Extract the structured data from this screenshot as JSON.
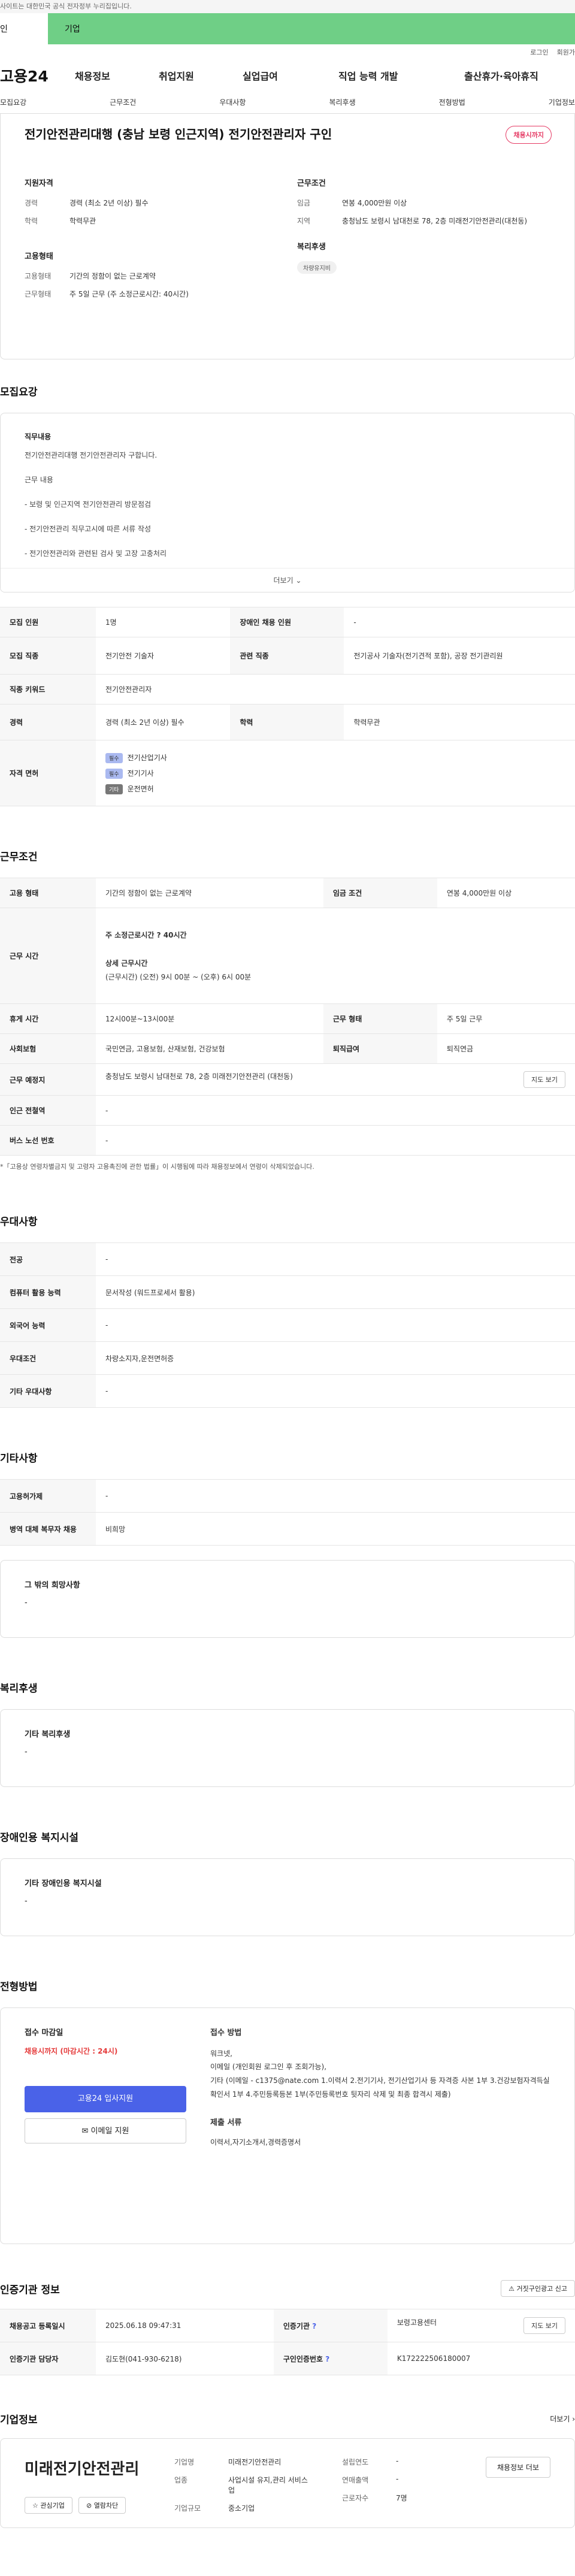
{
  "top": {
    "notice": "사이트는 대한민국 공식 전자정부 누리집입니다.",
    "tab_personal": "인",
    "tab_enterprise": "기업",
    "login": "로그인",
    "join": "회원가"
  },
  "gnb": {
    "logo": "고용24",
    "items": [
      "채용정보",
      "취업지원",
      "실업급여",
      "직업 능력 개발",
      "출산휴가·육아휴직"
    ]
  },
  "subnav": [
    "모집요강",
    "근무조건",
    "우대사항",
    "복리후생",
    "전형방법",
    "기업정보"
  ],
  "header": {
    "title": "전기안전관리대행 (충남 보령 인근지역) 전기안전관리자 구인",
    "badge": "채용시까지",
    "qual_title": "지원자격",
    "qual": [
      {
        "k": "경력",
        "v": "경력 (최소 2년 이상) 필수"
      },
      {
        "k": "학력",
        "v": "학력무관"
      }
    ],
    "emp_title": "고용형태",
    "emp": [
      {
        "k": "고용형태",
        "v": "기간의 정함이 없는 근로계약"
      },
      {
        "k": "근무형태",
        "v": "주 5일 근무 (주 소정근로시간: 40시간)"
      }
    ],
    "cond_title": "근무조건",
    "cond": [
      {
        "k": "임금",
        "v": "연봉 4,000만원 이상"
      },
      {
        "k": "지역",
        "v": "충청남도 보령시 남대천로 78, 2층 미래전기안전관리(대천동)"
      }
    ],
    "welfare_title": "복리후생",
    "welfare_chip": "차량유지비"
  },
  "recruit": {
    "section": "모집요강",
    "desc_title": "직무내용",
    "lines": [
      "전기안전관리대행 전기안전관리자 구합니다.",
      "근무 내용",
      "- 보령 및 인근지역 전기안전관리 방문점검",
      "- 전기안전관리 직무고시에 따른 서류 작성",
      "- 전기안전관리와 관련된 검사 및 고장 고충처리"
    ],
    "more": "더보기",
    "rows": [
      [
        "모집 인원",
        "1명",
        "장애인 채용 인원",
        "-"
      ],
      [
        "모집 직종",
        "전기안전 기술자",
        "관련 직종",
        "전기공사 기술자(전기견적 포함), 공장 전기관리원"
      ],
      [
        "직종 키워드",
        "전기안전관리자",
        "",
        ""
      ],
      [
        "경력",
        "경력 (최소 2년 이상) 필수",
        "학력",
        "학력무관"
      ]
    ],
    "license_label": "자격 면허",
    "licenses": [
      {
        "tag": "필수",
        "name": "전기산업기사"
      },
      {
        "tag": "필수",
        "name": "전기기사"
      },
      {
        "tag": "기타",
        "name": "운전면허"
      }
    ]
  },
  "work": {
    "section": "근무조건",
    "emp_k": "고용 형태",
    "emp_v": "기간의 정함이 없는 근로계약",
    "pay_k": "임금 조건",
    "pay_v": "연봉 4,000만원 이상",
    "time_k": "근무 시간",
    "time_main": "주 소정근로시간 ? 40시간",
    "time_detail_title": "상세 근무시간",
    "time_detail": "(근무시간) (오전) 9시 00분 ~ (오후) 6시 00분",
    "break_k": "휴게 시간",
    "break_v": "12시00분~13시00분",
    "form_k": "근무 형태",
    "form_v": "주 5일 근무",
    "ins_k": "사회보험",
    "ins_v": "국민연금, 고용보험, 산재보험, 건강보험",
    "ret_k": "퇴직급여",
    "ret_v": "퇴직연금",
    "place_k": "근무 예정지",
    "place_v": "충청남도 보령시 남대천로 78, 2층 미래전기안전관리 (대천동)",
    "map_btn": "지도 보기",
    "sub_k": "인근 전철역",
    "sub_v": "-",
    "bus_k": "버스 노선 번호",
    "bus_v": "-",
    "note": "*「고용상 연령차별금지 및 고령자 고용촉진에 관한 법률」이 시행됨에 따라 채용정보에서 연령이 삭제되었습니다."
  },
  "pref": {
    "section": "우대사항",
    "rows": [
      [
        "전공",
        "-"
      ],
      [
        "컴퓨터 활용 능력",
        "문서작성 (워드프로세서 활용)"
      ],
      [
        "외국어 능력",
        "-"
      ],
      [
        "우대조건",
        "차량소지자,운전면허증"
      ],
      [
        "기타 우대사항",
        "-"
      ]
    ]
  },
  "etc": {
    "section": "기타사항",
    "rows": [
      [
        "고용허가제",
        "-"
      ],
      [
        "병역 대체 복무자 채용",
        "비희망"
      ]
    ],
    "box_title": "그 밖의 희망사항",
    "box_v": "-"
  },
  "welfare": {
    "section": "복리후생",
    "title": "기타 복리후생",
    "v": "-"
  },
  "disabled": {
    "section": "장애인용 복지시설",
    "title": "기타 장애인용 복지시설",
    "v": "-"
  },
  "apply": {
    "section": "전형방법",
    "deadline_title": "접수 마감일",
    "deadline": "채용시까지 (마감시간 : 24시)",
    "method_title": "접수 방법",
    "methods": [
      "워크넷,",
      "이메일 (개인회원 로그인 후 조회가능),",
      "기타 (이메일 - c1375@nate.com 1.이력서 2.전기기사, 전기산업기사 등 자격증 사본 1부 3.건강보험자격득실확인서 1부 4.주민등록등본 1부(주민등록번호 뒷자리 삭제 및 최종 합격시 제출)"
    ],
    "docs_title": "제출 서류",
    "docs": "이력서,자기소개서,경력증명서",
    "btn_apply": "고용24 입사지원",
    "btn_email": "이메일 지원"
  },
  "cert": {
    "section": "인증기관 정보",
    "report_btn": "거짓구인광고 신고",
    "rows": [
      [
        "채용공고 등록일시",
        "2025.06.18 09:47:31",
        "인증기관",
        "보령고용센터"
      ],
      [
        "인증기관 담당자",
        "김도현(041-930-6218)",
        "구인인증번호",
        "K172222506180007"
      ]
    ],
    "map_btn": "지도 보기"
  },
  "corp": {
    "section": "기업정보",
    "more": "더보기",
    "logo": "미래전기안전관리",
    "cols": [
      [
        [
          "기업명",
          "미래전기안전관리"
        ],
        [
          "업종",
          "사업시설 유지,관리 서비스업"
        ],
        [
          "기업규모",
          "중소기업"
        ]
      ],
      [
        [
          "설립연도",
          "-"
        ],
        [
          "연매출액",
          "-"
        ],
        [
          "근로자수",
          "7명"
        ]
      ]
    ],
    "info_btn": "채용정보 더보",
    "btn_fav": "관심기업",
    "btn_block": "열람차단"
  }
}
